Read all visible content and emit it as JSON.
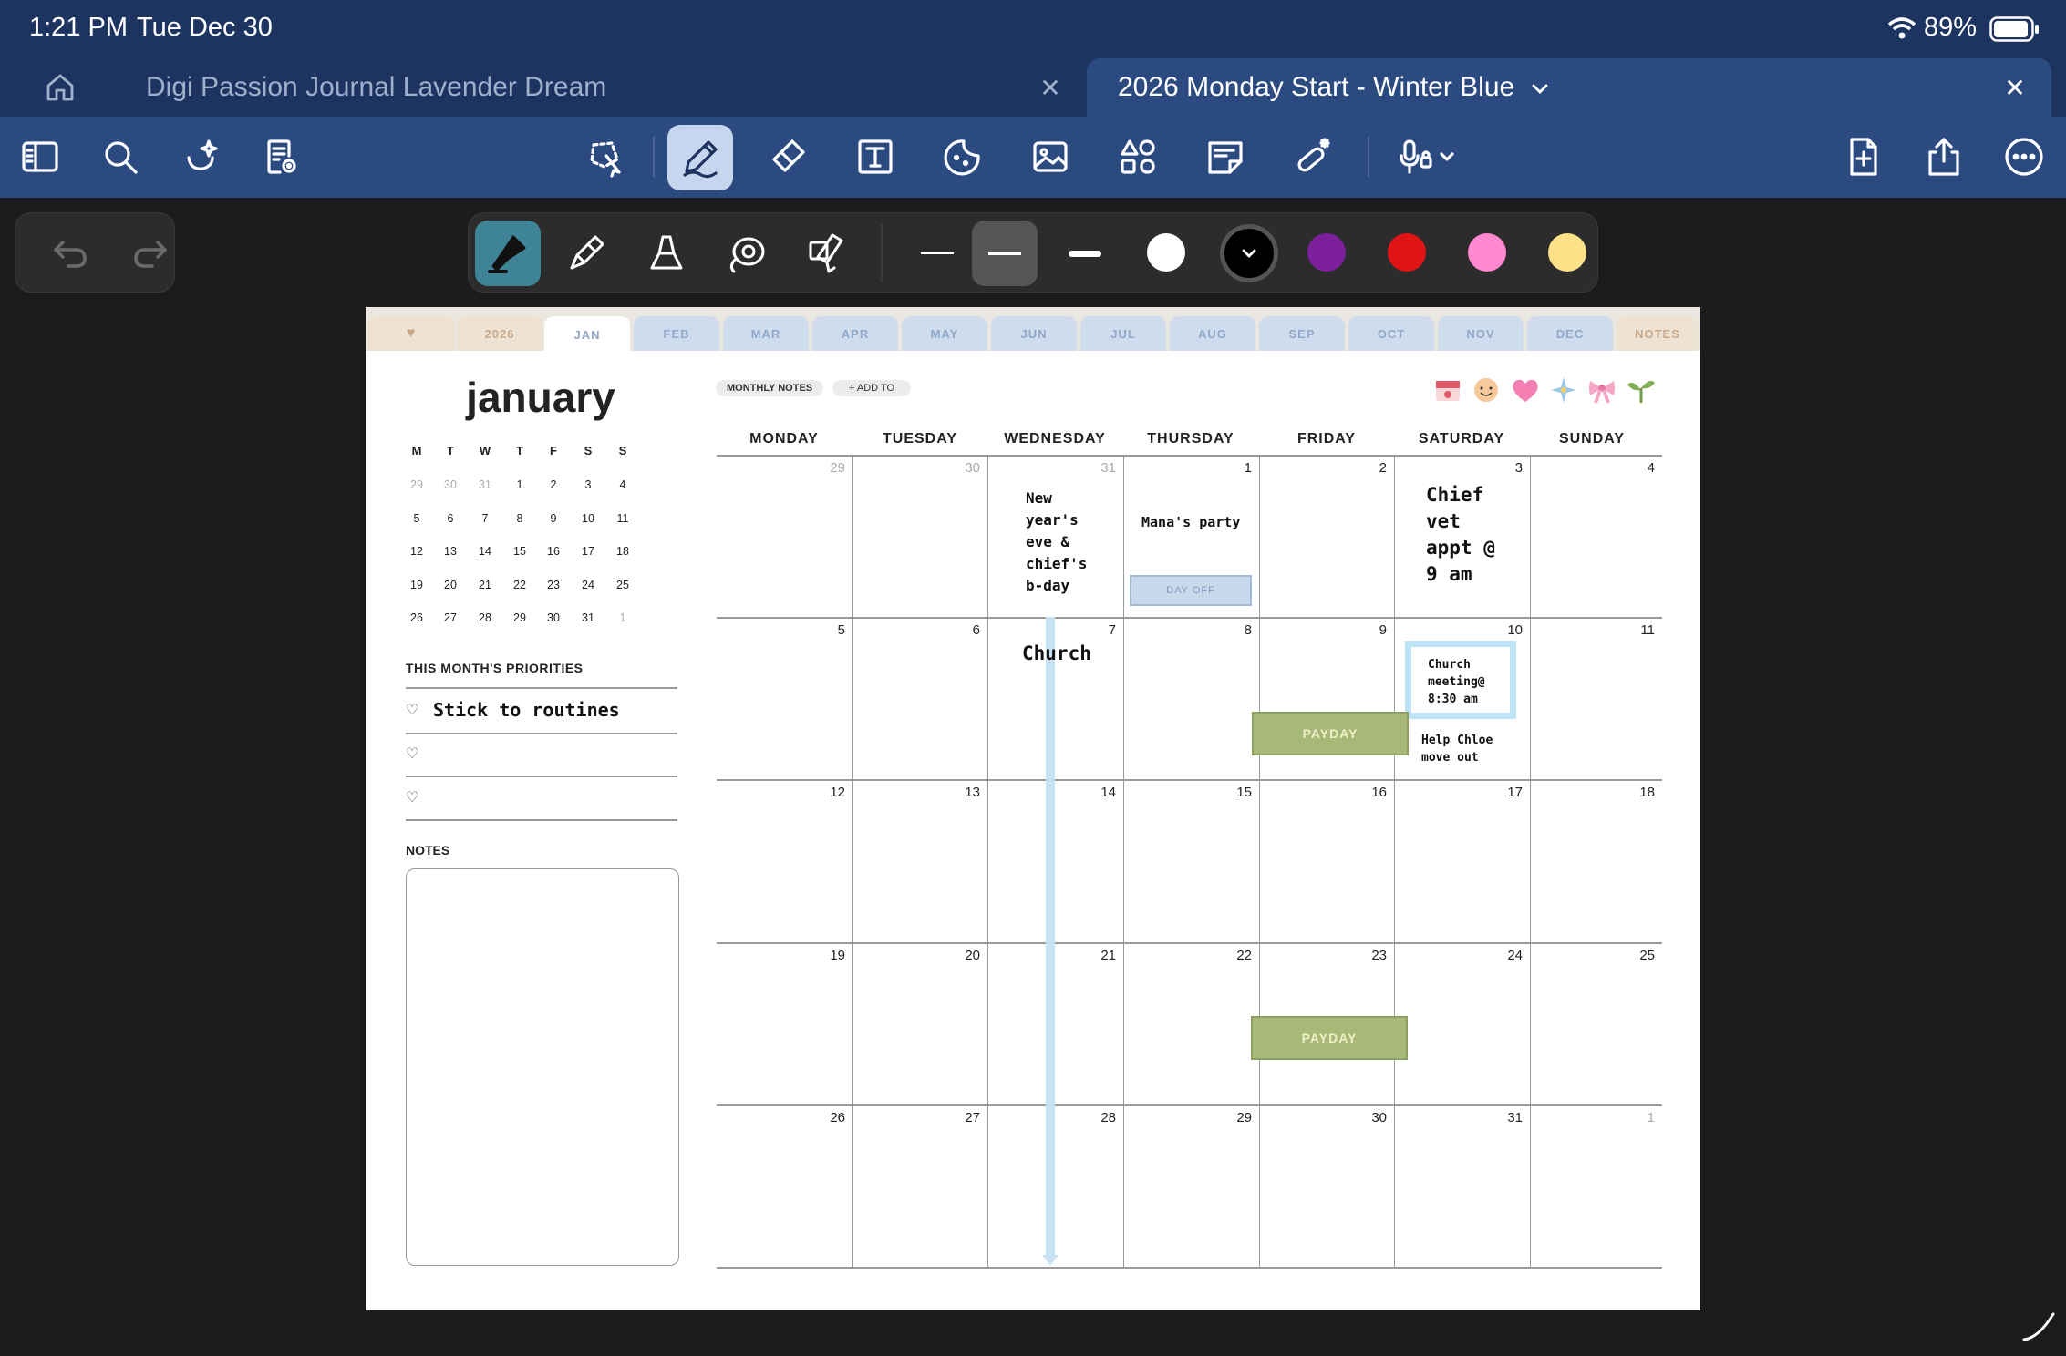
{
  "status_bar": {
    "time": "1:21 PM",
    "date": "Tue Dec 30",
    "battery": "89%"
  },
  "tabs": [
    {
      "label": "Digi Passion Journal Lavender Dream"
    },
    {
      "label": "2026 Monday Start - Winter Blue"
    }
  ],
  "toolbar": {
    "icons": [
      "sidebar-icon",
      "search-icon",
      "sparkle-lasso-icon",
      "page-settings-icon",
      "lasso-select-icon",
      "pen-icon",
      "eraser-icon",
      "text-box-icon",
      "sticker-icon",
      "image-icon",
      "shapes-icon",
      "sticky-note-icon",
      "magic-wand-icon",
      "voice-record-icon",
      "add-page-icon",
      "share-icon",
      "more-icon"
    ]
  },
  "pen_tray": {
    "colors": [
      "#ffffff",
      "#000000",
      "#7b1f9a",
      "#e01414",
      "#ff88d0",
      "#fde28a"
    ]
  },
  "planner": {
    "month_tabs": [
      "♥",
      "2026",
      "JAN",
      "FEB",
      "MAR",
      "APR",
      "MAY",
      "JUN",
      "JUL",
      "AUG",
      "SEP",
      "OCT",
      "NOV",
      "DEC",
      "NOTES"
    ],
    "month_title": "january",
    "mini_calendar": {
      "headers": [
        "M",
        "T",
        "W",
        "T",
        "F",
        "S",
        "S"
      ],
      "weeks": [
        [
          "29",
          "30",
          "31",
          "1",
          "2",
          "3",
          "4"
        ],
        [
          "5",
          "6",
          "7",
          "8",
          "9",
          "10",
          "11"
        ],
        [
          "12",
          "13",
          "14",
          "15",
          "16",
          "17",
          "18"
        ],
        [
          "19",
          "20",
          "21",
          "22",
          "23",
          "24",
          "25"
        ],
        [
          "26",
          "27",
          "28",
          "29",
          "30",
          "31",
          "1"
        ]
      ]
    },
    "priorities_heading": "THIS MONTH'S PRIORITIES",
    "priorities": [
      "Stick to routines",
      "",
      ""
    ],
    "notes_heading": "NOTES",
    "monthly_notes_button": "MONTHLY NOTES",
    "add_to_button": "+ ADD TO",
    "weekday_headers": [
      "MONDAY",
      "TUESDAY",
      "WEDNESDAY",
      "THURSDAY",
      "FRIDAY",
      "SATURDAY",
      "SUNDAY"
    ],
    "weeks": [
      [
        "29",
        "30",
        "31",
        "1",
        "2",
        "3",
        "4"
      ],
      [
        "5",
        "6",
        "7",
        "8",
        "9",
        "10",
        "11"
      ],
      [
        "12",
        "13",
        "14",
        "15",
        "16",
        "17",
        "18"
      ],
      [
        "19",
        "20",
        "21",
        "22",
        "23",
        "24",
        "25"
      ],
      [
        "26",
        "27",
        "28",
        "29",
        "30",
        "31",
        "1"
      ]
    ],
    "entries": {
      "new_years": [
        "New",
        "year's",
        "eve &",
        "chief's",
        "b-day"
      ],
      "manas_party": "Mana's party",
      "day_off": "DAY OFF",
      "chief_vet": [
        "Chief",
        "vet",
        "appt @",
        "9 am"
      ],
      "church": "Church",
      "church_meeting": [
        "Church",
        "meeting@",
        "8:30 am"
      ],
      "help_chloe": [
        "Help Chloe",
        "move out"
      ],
      "payday_1": "PAYDAY",
      "payday_2": "PAYDAY"
    },
    "stickers": [
      "calendar-sticker",
      "smiley-sticker",
      "heart-sticker",
      "sparkle-sticker",
      "bow-sticker",
      "sprout-sticker"
    ]
  }
}
